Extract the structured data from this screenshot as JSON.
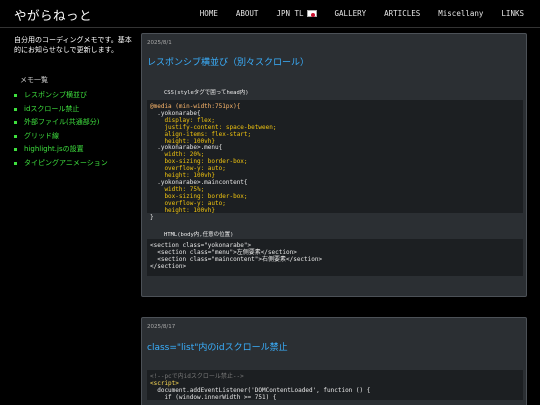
{
  "header": {
    "brand": "やがらねっと",
    "nav": [
      "HOME",
      "ABOUT",
      "JPN TL",
      "GALLERY",
      "ARTICLES",
      "Miscellany",
      "LINKS"
    ]
  },
  "sidebar": {
    "intro": "自分用のコーディングメモです。基本的にお知らせなしで更新します。",
    "memo_heading": "メモ一覧",
    "items": [
      "レスポンシブ横並び",
      "idスクロール禁止",
      "外部ファイル(共通部分)",
      "グリッド線",
      "highlight.jsの設置",
      "タイピングアニメーション"
    ]
  },
  "posts": [
    {
      "date": "2025/8/1",
      "title": "レスポンシブ横並び（別々スクロール）",
      "css_caption": "CSS(styleタグで囲ってhead内)",
      "html_caption": "HTML(body内,任意の位置)",
      "css_lines": [
        "@media (min-width:751px){",
        "  .yokonarabe{",
        "    display: flex;",
        "    justify-content: space-between;",
        "    align-items: flex-start;",
        "    height: 100vh}",
        "  .yokonarabe>.menu{",
        "    width: 20%;",
        "    box-sizing: border-box;",
        "    overflow-y: auto;",
        "    height: 100vh}",
        "  .yokonarabe>.maincontent{",
        "    width: 75%;",
        "    box-sizing: border-box;",
        "    overflow-y: auto;",
        "    height: 100vh}",
        "}"
      ],
      "html_lines": [
        "<section class=\"yokonarabe\">",
        "  <section class=\"menu\">左側要素</section>",
        "  <section class=\"maincontent\">右側要素</section>",
        "</section>"
      ]
    },
    {
      "date": "2025/8/17",
      "title": "class=\"list\"内のidスクロール禁止",
      "code_lines": [
        "<!--pcで内idスクロール禁止-->",
        "<script>",
        "  document.addEventListener('DOMContentLoaded', function () {",
        "    if (window.innerWidth >= 751) {"
      ]
    }
  ],
  "colors": {
    "accent_blue": "#3ab0ff",
    "memo_green": "#3ee03e",
    "card_bg": "#2b2f33",
    "code_bg": "#1c1f22"
  }
}
